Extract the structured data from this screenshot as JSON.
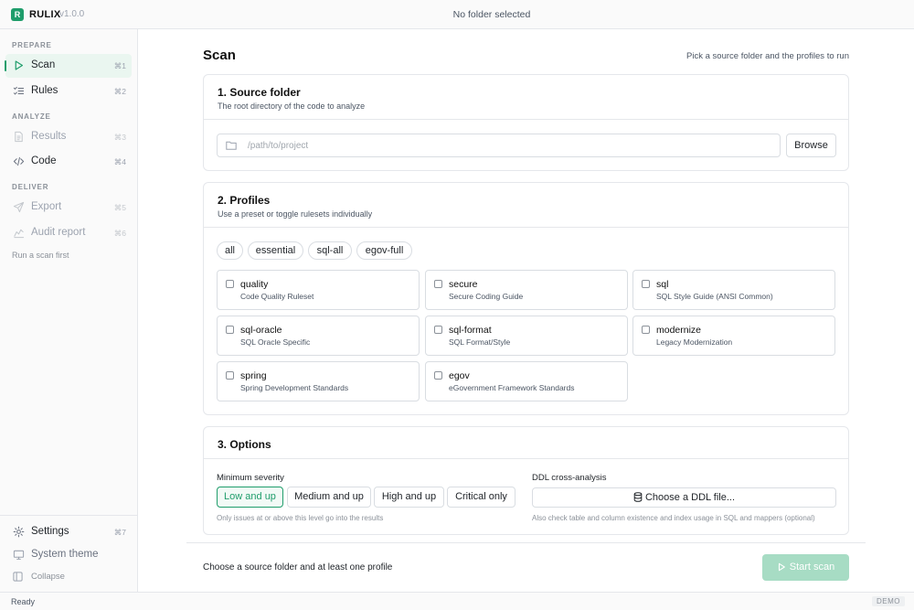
{
  "app": {
    "logo_letter": "R",
    "name": "RULIX",
    "version": "v1.0.0",
    "folder_status": "No folder selected",
    "accent_color": "#1f9d6b"
  },
  "sidebar": {
    "sections": [
      {
        "label": "PREPARE",
        "items": [
          {
            "label": "Scan",
            "shortcut": "⌘1",
            "icon": "play-icon",
            "active": true,
            "disabled": false
          },
          {
            "label": "Rules",
            "shortcut": "⌘2",
            "icon": "list-check-icon",
            "active": false,
            "disabled": false
          }
        ]
      },
      {
        "label": "ANALYZE",
        "items": [
          {
            "label": "Results",
            "shortcut": "⌘3",
            "icon": "document-icon",
            "active": false,
            "disabled": true
          },
          {
            "label": "Code",
            "shortcut": "⌘4",
            "icon": "code-icon",
            "active": false,
            "disabled": false
          }
        ]
      },
      {
        "label": "DELIVER",
        "items": [
          {
            "label": "Export",
            "shortcut": "⌘5",
            "icon": "send-icon",
            "active": false,
            "disabled": true
          },
          {
            "label": "Audit report",
            "shortcut": "⌘6",
            "icon": "audit-icon",
            "active": false,
            "disabled": true
          }
        ]
      }
    ],
    "hint": "Run a scan first",
    "settings_label": "Settings",
    "settings_shortcut": "⌘7",
    "theme_label": "System theme",
    "collapse_label": "Collapse"
  },
  "main": {
    "title": "Scan",
    "hint": "Pick a source folder and the profiles to run",
    "source": {
      "title": "1. Source folder",
      "subtitle": "The root directory of the code to analyze",
      "path_value": "",
      "path_placeholder": "/path/to/project",
      "browse_label": "Browse"
    },
    "profiles": {
      "title": "2. Profiles",
      "subtitle": "Use a preset or toggle rulesets individually",
      "presets": [
        "all",
        "essential",
        "sql-all",
        "egov-full"
      ],
      "items": [
        {
          "name": "quality",
          "desc": "Code Quality Ruleset",
          "checked": false
        },
        {
          "name": "secure",
          "desc": "Secure Coding Guide",
          "checked": false
        },
        {
          "name": "sql",
          "desc": "SQL Style Guide (ANSI Common)",
          "checked": false
        },
        {
          "name": "sql-oracle",
          "desc": "SQL Oracle Specific",
          "checked": false
        },
        {
          "name": "sql-format",
          "desc": "SQL Format/Style",
          "checked": false
        },
        {
          "name": "modernize",
          "desc": "Legacy Modernization",
          "checked": false
        },
        {
          "name": "spring",
          "desc": "Spring Development Standards",
          "checked": false
        },
        {
          "name": "egov",
          "desc": "eGovernment Framework Standards",
          "checked": false
        }
      ]
    },
    "options": {
      "title": "3. Options",
      "severity_label": "Minimum severity",
      "severity_options": [
        "Low and up",
        "Medium and up",
        "High and up",
        "Critical only"
      ],
      "severity_selected": "Low and up",
      "severity_hint": "Only issues at or above this level go into the results",
      "ddl_label": "DDL cross-analysis",
      "ddl_button": "Choose a DDL file...",
      "ddl_hint": "Also check table and column existence and index usage in SQL and mappers (optional)"
    },
    "footer": {
      "hint": "Choose a source folder and at least one profile",
      "start_label": "Start scan"
    }
  },
  "statusbar": {
    "status": "Ready",
    "badge": "DEMO"
  }
}
